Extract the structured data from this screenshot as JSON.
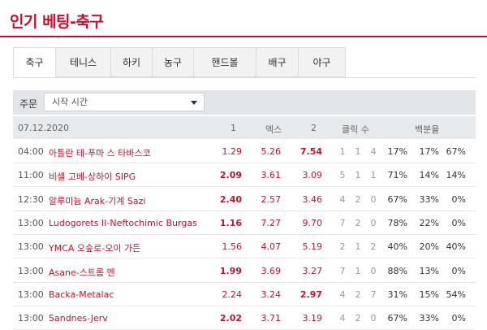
{
  "page": {
    "title": "인기 베팅-축구"
  },
  "tabs": [
    {
      "label": "축구",
      "active": true
    },
    {
      "label": "테니스",
      "active": false
    },
    {
      "label": "하키",
      "active": false
    },
    {
      "label": "농구",
      "active": false
    },
    {
      "label": "핸드볼",
      "active": false
    },
    {
      "label": "배구",
      "active": false
    },
    {
      "label": "야구",
      "active": false
    }
  ],
  "filter": {
    "label": "주문",
    "selected": "시작 시간"
  },
  "table": {
    "date": "07.12.2020",
    "headers": {
      "one": "1",
      "x": "엑스",
      "two": "2",
      "clicks": "클릭 수",
      "percent": "백분율"
    },
    "rows": [
      {
        "time": "04:00",
        "match": "아틀란 테-푸마 스 타바스코",
        "o1": "1.29",
        "ox": "5.26",
        "o2": "7.54",
        "bold": "o2",
        "c1": "1",
        "c2": "1",
        "c3": "4",
        "p1": "17%",
        "p2": "17%",
        "p3": "67%"
      },
      {
        "time": "11:00",
        "match": "비셀 고베-상하이 SIPG",
        "o1": "2.09",
        "ox": "3.61",
        "o2": "3.09",
        "bold": "o1",
        "c1": "5",
        "c2": "1",
        "c3": "1",
        "p1": "71%",
        "p2": "14%",
        "p3": "14%"
      },
      {
        "time": "12:30",
        "match": "알루미늄 Arak-기계 Sazi",
        "o1": "2.40",
        "ox": "2.57",
        "o2": "3.46",
        "bold": "o1",
        "c1": "4",
        "c2": "2",
        "c3": "0",
        "p1": "67%",
        "p2": "33%",
        "p3": "0%"
      },
      {
        "time": "13:00",
        "match": "Ludogorets II-Neftochimic Burgas",
        "o1": "1.16",
        "ox": "7.27",
        "o2": "9.70",
        "bold": "o1",
        "c1": "7",
        "c2": "2",
        "c3": "0",
        "p1": "78%",
        "p2": "22%",
        "p3": "0%"
      },
      {
        "time": "13:00",
        "match": "YMCA 오숲로-오이 가든",
        "o1": "1.56",
        "ox": "4.07",
        "o2": "5.19",
        "bold": "",
        "c1": "2",
        "c2": "1",
        "c3": "2",
        "p1": "40%",
        "p2": "20%",
        "p3": "40%"
      },
      {
        "time": "13:00",
        "match": "Asane-스트롬 멘",
        "o1": "1.99",
        "ox": "3.69",
        "o2": "3.27",
        "bold": "o1",
        "c1": "7",
        "c2": "1",
        "c3": "0",
        "p1": "88%",
        "p2": "13%",
        "p3": "0%"
      },
      {
        "time": "13:00",
        "match": "Backa-Metalac",
        "o1": "2.24",
        "ox": "3.24",
        "o2": "2.97",
        "bold": "o2",
        "c1": "4",
        "c2": "2",
        "c3": "7",
        "p1": "31%",
        "p2": "15%",
        "p3": "54%"
      },
      {
        "time": "13:00",
        "match": "Sandnes-Jerv",
        "o1": "2.02",
        "ox": "3.71",
        "o2": "3.19",
        "bold": "o1",
        "c1": "4",
        "c2": "2",
        "c3": "0",
        "p1": "67%",
        "p2": "33%",
        "p3": "0%"
      }
    ]
  }
}
